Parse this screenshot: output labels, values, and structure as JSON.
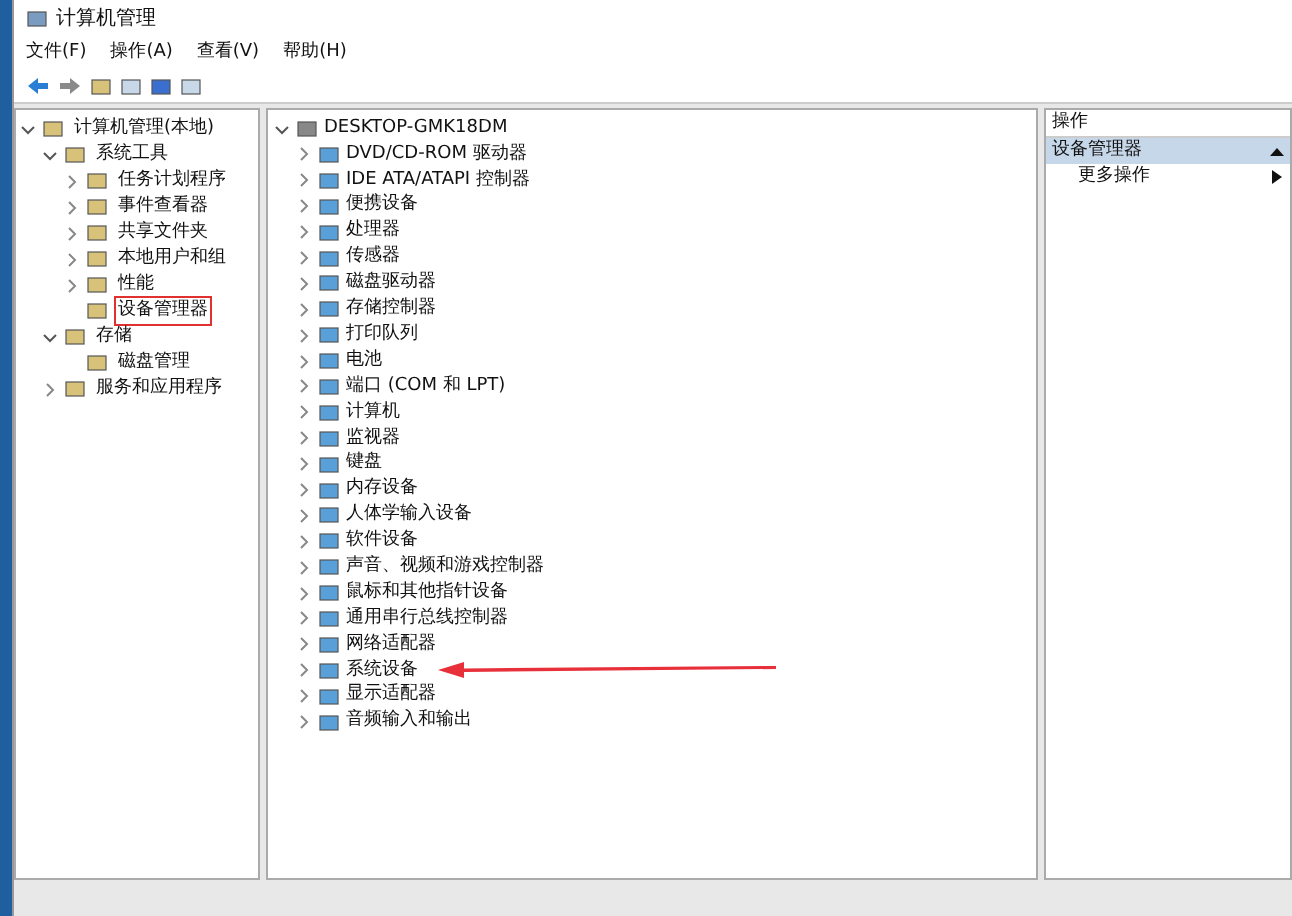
{
  "window": {
    "title": "计算机管理"
  },
  "menu": [
    "文件(F)",
    "操作(A)",
    "查看(V)",
    "帮助(H)"
  ],
  "tree": {
    "label": "计算机管理(本地)",
    "expanded": true,
    "children": [
      {
        "label": "系统工具",
        "expanded": true,
        "children": [
          {
            "label": "任务计划程序",
            "expanded": false,
            "selected": false
          },
          {
            "label": "事件查看器",
            "expanded": false,
            "selected": false
          },
          {
            "label": "共享文件夹",
            "expanded": false,
            "selected": false
          },
          {
            "label": "本地用户和组",
            "expanded": false,
            "selected": false
          },
          {
            "label": "性能",
            "expanded": false,
            "selected": false
          },
          {
            "label": "设备管理器",
            "selected": true
          }
        ]
      },
      {
        "label": "存储",
        "expanded": true,
        "children": [
          {
            "label": "磁盘管理",
            "selected": false
          }
        ]
      },
      {
        "label": "服务和应用程序",
        "expanded": false
      }
    ]
  },
  "devices": {
    "computer": "DESKTOP-GMK18DM",
    "expanded": true,
    "categories": [
      {
        "label": "DVD/CD-ROM 驱动器",
        "marked": false
      },
      {
        "label": "IDE ATA/ATAPI 控制器",
        "marked": false
      },
      {
        "label": "便携设备",
        "marked": false
      },
      {
        "label": "处理器",
        "marked": false
      },
      {
        "label": "传感器",
        "marked": false
      },
      {
        "label": "磁盘驱动器",
        "marked": false
      },
      {
        "label": "存储控制器",
        "marked": false
      },
      {
        "label": "打印队列",
        "marked": false
      },
      {
        "label": "电池",
        "marked": false
      },
      {
        "label": "端口 (COM 和 LPT)",
        "marked": false
      },
      {
        "label": "计算机",
        "marked": false
      },
      {
        "label": "监视器",
        "marked": false
      },
      {
        "label": "键盘",
        "marked": false
      },
      {
        "label": "内存设备",
        "marked": false
      },
      {
        "label": "人体学输入设备",
        "marked": false
      },
      {
        "label": "软件设备",
        "marked": false
      },
      {
        "label": "声音、视频和游戏控制器",
        "marked": false
      },
      {
        "label": "鼠标和其他指针设备",
        "marked": false
      },
      {
        "label": "通用串行总线控制器",
        "marked": false
      },
      {
        "label": "网络适配器",
        "marked": false
      },
      {
        "label": "系统设备",
        "marked": true
      },
      {
        "label": "显示适配器",
        "marked": false
      },
      {
        "label": "音频输入和输出",
        "marked": false
      }
    ]
  },
  "actions": {
    "header": "操作",
    "section": "设备管理器",
    "expanded": true,
    "items": [
      "更多操作"
    ]
  }
}
